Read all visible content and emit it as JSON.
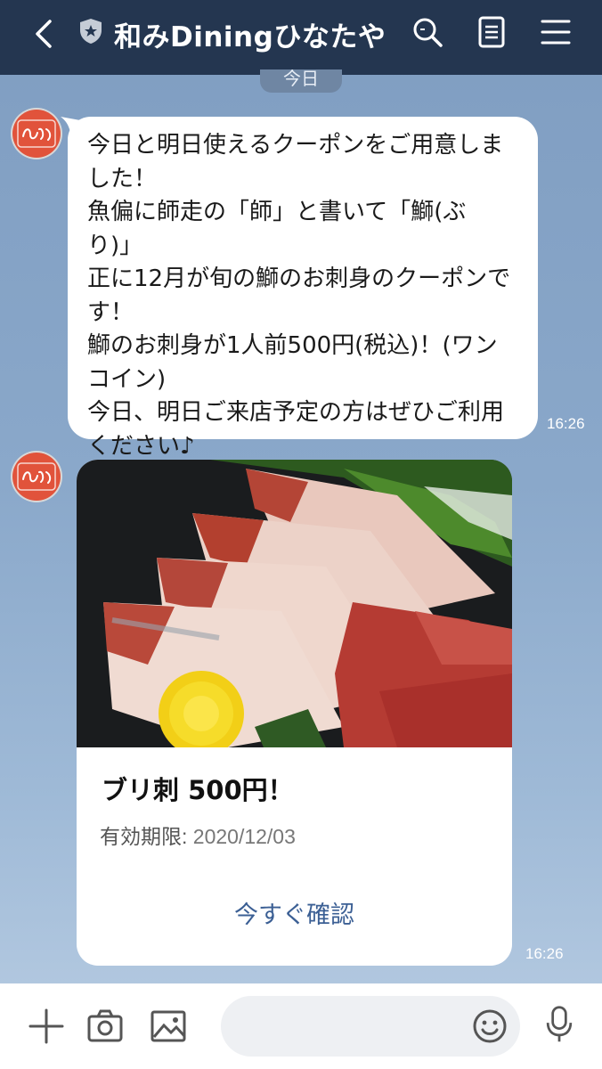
{
  "header": {
    "title": "和みDiningひなたや",
    "icons": [
      "back-chevron-icon",
      "shield-star-icon",
      "search-icon",
      "notes-icon",
      "menu-icon"
    ],
    "background": "#243650"
  },
  "chat": {
    "date_label": "今日",
    "messages": [
      {
        "type": "text",
        "text": "今日と明日使えるクーポンをご用意しました！\n魚偏に師走の「師」と書いて「鰤(ぶり)」\n正に12月が旬の鰤のお刺身のクーポンです！\n鰤のお刺身が1人前500円(税込)！(ワンコイン)\n今日、明日ご来店予定の方はぜひご利用ください♪",
        "time": "16:26"
      },
      {
        "type": "coupon",
        "title": "ブリ刺 500円！",
        "expiry_label": "有効期限:",
        "expiry_date": "2020/12/03",
        "button_label": "今すぐ確認",
        "time": "16:26"
      }
    ]
  },
  "input_bar": {
    "placeholder": "",
    "icons": [
      "plus-icon",
      "camera-icon",
      "image-icon",
      "emoji-icon",
      "mic-icon"
    ]
  },
  "colors": {
    "accent_link": "#3b5f94",
    "avatar": "#e1533b"
  }
}
